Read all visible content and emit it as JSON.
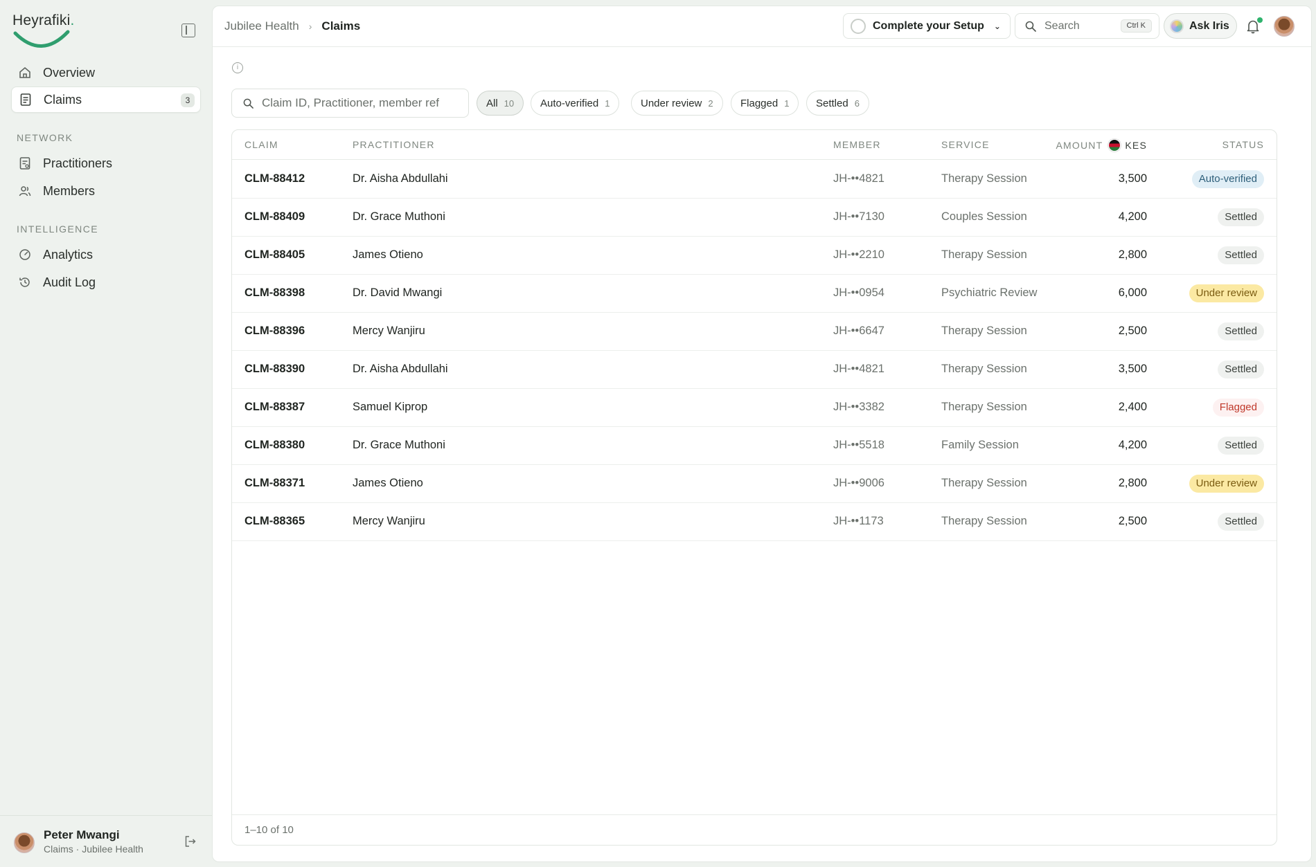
{
  "brand": {
    "name": "Heyrafiki",
    "dot": ".",
    "accent": "#2f9e6e"
  },
  "sidebar": {
    "overview": {
      "label": "Overview",
      "icon": "home-icon"
    },
    "claims": {
      "label": "Claims",
      "icon": "document-icon",
      "badge": "3"
    },
    "section_network": "NETWORK",
    "practitioners": {
      "label": "Practitioners",
      "icon": "clipboard-icon"
    },
    "members": {
      "label": "Members",
      "icon": "users-icon"
    },
    "section_intelligence": "INTELLIGENCE",
    "analytics": {
      "label": "Analytics",
      "icon": "gauge-icon"
    },
    "audit_log": {
      "label": "Audit Log",
      "icon": "history-icon"
    },
    "user": {
      "name": "Peter Mwangi",
      "role": "Claims · Jubilee Health"
    }
  },
  "header": {
    "breadcrumb_root": "Jubilee Health",
    "breadcrumb_current": "Claims",
    "setup_label": "Complete your Setup",
    "search_placeholder": "Search",
    "search_shortcut": "Ctrl K",
    "iris_label": "Ask Iris"
  },
  "filters": {
    "search_placeholder": "Claim ID, Practitioner, member ref",
    "chips": [
      {
        "label": "All",
        "count": "10"
      },
      {
        "label": "Auto-verified",
        "count": "1"
      },
      {
        "label": "Under review",
        "count": "2"
      },
      {
        "label": "Flagged",
        "count": "1"
      },
      {
        "label": "Settled",
        "count": "6"
      }
    ]
  },
  "table": {
    "columns": {
      "claim": "CLAIM",
      "practitioner": "PRACTITIONER",
      "member": "MEMBER",
      "service": "SERVICE",
      "amount": "AMOUNT",
      "currency": "KES",
      "status": "STATUS"
    },
    "rows": [
      {
        "claim": "CLM-88412",
        "practitioner": "Dr. Aisha Abdullahi",
        "member": "JH-••4821",
        "service": "Therapy Session",
        "amount": "3,500",
        "status": "Auto-verified"
      },
      {
        "claim": "CLM-88409",
        "practitioner": "Dr. Grace Muthoni",
        "member": "JH-••7130",
        "service": "Couples Session",
        "amount": "4,200",
        "status": "Settled"
      },
      {
        "claim": "CLM-88405",
        "practitioner": "James Otieno",
        "member": "JH-••2210",
        "service": "Therapy Session",
        "amount": "2,800",
        "status": "Settled"
      },
      {
        "claim": "CLM-88398",
        "practitioner": "Dr. David Mwangi",
        "member": "JH-••0954",
        "service": "Psychiatric Review",
        "amount": "6,000",
        "status": "Under review"
      },
      {
        "claim": "CLM-88396",
        "practitioner": "Mercy Wanjiru",
        "member": "JH-••6647",
        "service": "Therapy Session",
        "amount": "2,500",
        "status": "Settled"
      },
      {
        "claim": "CLM-88390",
        "practitioner": "Dr. Aisha Abdullahi",
        "member": "JH-••4821",
        "service": "Therapy Session",
        "amount": "3,500",
        "status": "Settled"
      },
      {
        "claim": "CLM-88387",
        "practitioner": "Samuel Kiprop",
        "member": "JH-••3382",
        "service": "Therapy Session",
        "amount": "2,400",
        "status": "Flagged"
      },
      {
        "claim": "CLM-88380",
        "practitioner": "Dr. Grace Muthoni",
        "member": "JH-••5518",
        "service": "Family Session",
        "amount": "4,200",
        "status": "Settled"
      },
      {
        "claim": "CLM-88371",
        "practitioner": "James Otieno",
        "member": "JH-••9006",
        "service": "Therapy Session",
        "amount": "2,800",
        "status": "Under review"
      },
      {
        "claim": "CLM-88365",
        "practitioner": "Mercy Wanjiru",
        "member": "JH-••1173",
        "service": "Therapy Session",
        "amount": "2,500",
        "status": "Settled"
      }
    ],
    "footer": "1–10 of 10"
  },
  "status_colors": {
    "Auto-verified": "#2e5f7a",
    "Settled": "#3b413c",
    "Under review": "#7a5b10",
    "Flagged": "#c0392b"
  }
}
